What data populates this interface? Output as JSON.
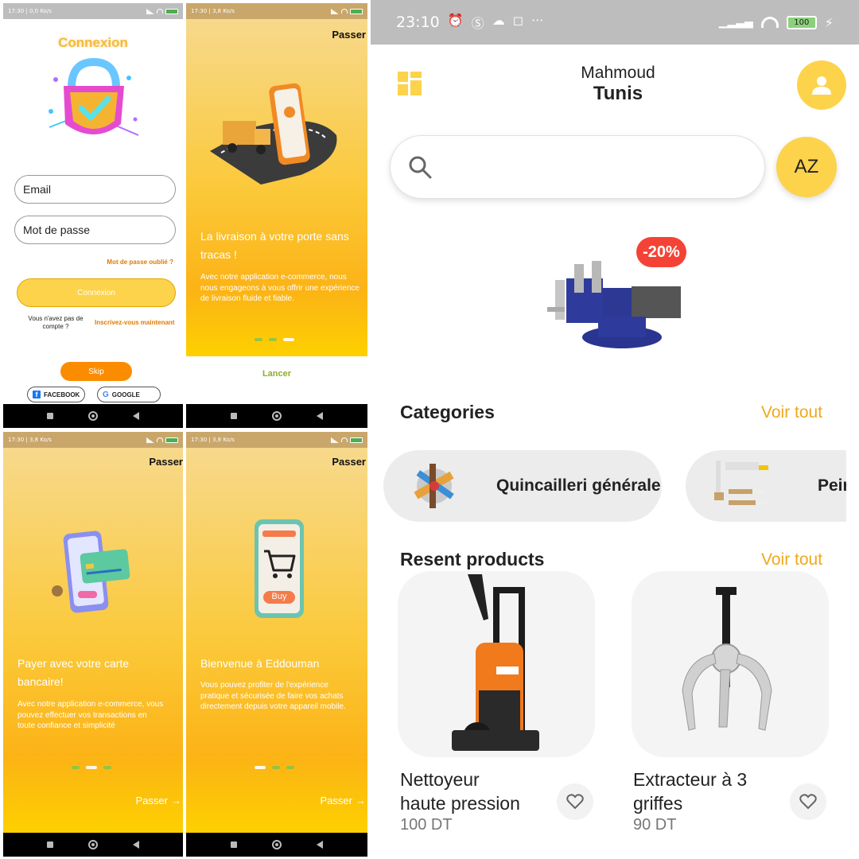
{
  "login": {
    "status": "17:30 | 0,0 Ko/s",
    "title": "Connexion",
    "email_placeholder": "Email",
    "password_placeholder": "Mot de passe",
    "forgot": "Mot de passe oublié ?",
    "button": "Connexion",
    "no_account": "Vous n'avez pas de compte ?",
    "register": "Inscrivez-vous maintenant",
    "skip": "Skip",
    "facebook": "FACEBOOK",
    "google": "GOOGLE"
  },
  "onboarding_delivery": {
    "status": "17:30 | 3,8 Ko/s",
    "skip": "Passer",
    "title": "La livraison à votre porte sans tracas !",
    "desc": "Avec notre application e-commerce, nous nous engageons à vous offrir une expérience de livraison fluide et fiable.",
    "launch": "Lancer"
  },
  "onboarding_card": {
    "status": "17:30 | 3,8 Ko/s",
    "skip": "Passer",
    "title": "Payer avec votre carte bancaire!",
    "desc": "Avec notre application e-commerce, vous pouvez effectuer vos transactions en toute confiance et simplicité",
    "next": "Passer"
  },
  "onboarding_welcome": {
    "status": "17:30 | 3,8 Ko/s",
    "skip": "Passer",
    "title": "Bienvenue à Eddouman",
    "desc": "Vous pouvez profiter de l'expérience pratique et sécurisée de faire vos achats directement depuis votre appareil mobile.",
    "next": "Passer",
    "buy": "Buy"
  },
  "home": {
    "status_time": "23:10",
    "battery": "100",
    "user_name": "Mahmoud",
    "user_city": "Tunis",
    "sort_label": "AZ",
    "discount": "-20%",
    "categories_title": "Categories",
    "categories_see_all": "Voir tout",
    "categories": [
      {
        "label": "Quincailleri générale"
      },
      {
        "label": "Peinture"
      }
    ],
    "recent_title": "Resent products",
    "recent_see_all": "Voir tout",
    "products": [
      {
        "name_line1": "Nettoyeur",
        "name_line2": "haute pression",
        "price": "100 DT"
      },
      {
        "name_line1": "Extracteur à 3",
        "name_line2": "griffes",
        "price": "90 DT"
      }
    ],
    "colors": {
      "accent": "#fcd34b",
      "see_all": "#f0a81e",
      "discount": "#f44336"
    }
  }
}
